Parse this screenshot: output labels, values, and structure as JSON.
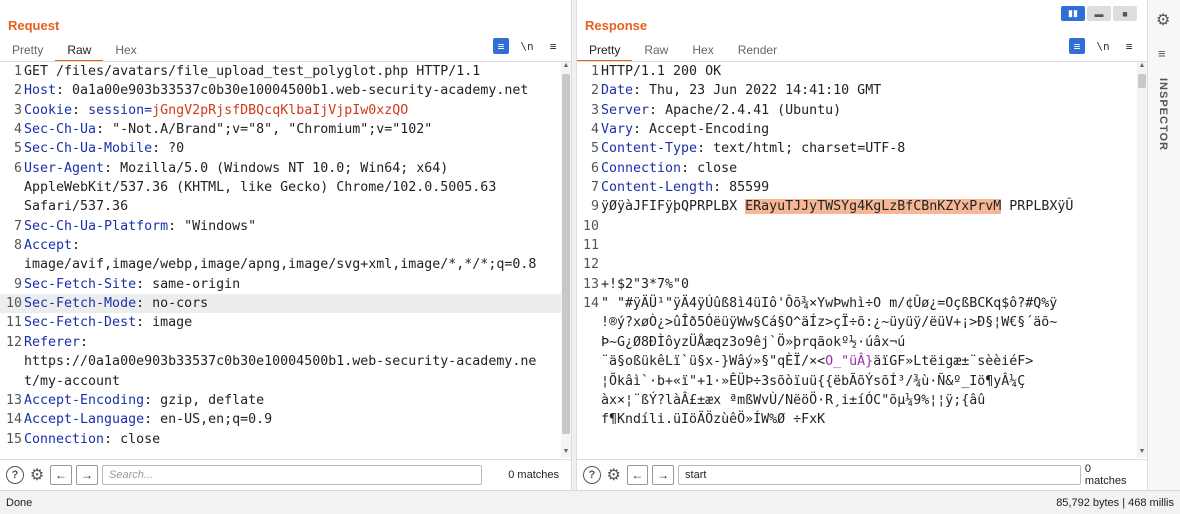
{
  "request": {
    "title": "Request",
    "tabs": [
      "Pretty",
      "Raw",
      "Hex"
    ],
    "active_tab": "Raw",
    "tools": [
      "wrap-lines",
      "\\n",
      "≡"
    ],
    "lines": [
      {
        "n": "1",
        "name": "",
        "sep": "",
        "value": "GET /files/avatars/file_upload_test_polyglot.php HTTP/1.1",
        "cont": []
      },
      {
        "n": "2",
        "name": "Host",
        "sep": ": ",
        "value": "0a1a00e903b33537c0b30e10004500b1.web-security-academy.net",
        "cont": []
      },
      {
        "n": "3",
        "name": "Cookie",
        "sep": ": ",
        "value": "session=jGngV2pRjsfDBQcqKlbaIjVjpIw0xzQO",
        "cont": []
      },
      {
        "n": "4",
        "name": "Sec-Ch-Ua",
        "sep": ": ",
        "value": "\"-Not.A/Brand\";v=\"8\", \"Chromium\";v=\"102\"",
        "cont": []
      },
      {
        "n": "5",
        "name": "Sec-Ch-Ua-Mobile",
        "sep": ": ",
        "value": "?0",
        "cont": []
      },
      {
        "n": "6",
        "name": "User-Agent",
        "sep": ": ",
        "value": "Mozilla/5.0 (Windows NT 10.0; Win64; x64)",
        "cont": [
          "AppleWebKit/537.36 (KHTML, like Gecko) Chrome/102.0.5005.63",
          "Safari/537.36"
        ]
      },
      {
        "n": "7",
        "name": "Sec-Ch-Ua-Platform",
        "sep": ": ",
        "value": "\"Windows\"",
        "cont": []
      },
      {
        "n": "8",
        "name": "Accept",
        "sep": ":",
        "value": "",
        "cont": [
          "image/avif,image/webp,image/apng,image/svg+xml,image/*,*/*;q=0.8"
        ]
      },
      {
        "n": "9",
        "name": "Sec-Fetch-Site",
        "sep": ": ",
        "value": "same-origin",
        "cont": []
      },
      {
        "n": "10",
        "name": "Sec-Fetch-Mode",
        "sep": ": ",
        "value": "no-cors",
        "cont": []
      },
      {
        "n": "11",
        "name": "Sec-Fetch-Dest",
        "sep": ": ",
        "value": "image",
        "cont": []
      },
      {
        "n": "12",
        "name": "Referer",
        "sep": ":",
        "value": "",
        "cont": [
          "https://0a1a00e903b33537c0b30e10004500b1.web-security-academy.ne",
          "t/my-account"
        ]
      },
      {
        "n": "13",
        "name": "Accept-Encoding",
        "sep": ": ",
        "value": "gzip, deflate",
        "cont": []
      },
      {
        "n": "14",
        "name": "Accept-Language",
        "sep": ": ",
        "value": "en-US,en;q=0.9",
        "cont": []
      },
      {
        "n": "15",
        "name": "Connection",
        "sep": ": ",
        "value": "close",
        "cont": []
      }
    ],
    "search_placeholder": "Search...",
    "search_value": "",
    "matches": "0 matches"
  },
  "response": {
    "title": "Response",
    "tabs": [
      "Pretty",
      "Raw",
      "Hex",
      "Render"
    ],
    "active_tab": "Pretty",
    "lines": [
      {
        "n": "1",
        "name": "",
        "sep": "",
        "value": "HTTP/1.1 200 OK"
      },
      {
        "n": "2",
        "name": "Date",
        "sep": ": ",
        "value": "Thu, 23 Jun 2022 14:41:10 GMT"
      },
      {
        "n": "3",
        "name": "Server",
        "sep": ": ",
        "value": "Apache/2.4.41 (Ubuntu)"
      },
      {
        "n": "4",
        "name": "Vary",
        "sep": ": ",
        "value": "Accept-Encoding"
      },
      {
        "n": "5",
        "name": "Content-Type",
        "sep": ": ",
        "value": "text/html; charset=UTF-8"
      },
      {
        "n": "6",
        "name": "Connection",
        "sep": ": ",
        "value": "close"
      },
      {
        "n": "7",
        "name": "Content-Length",
        "sep": ": ",
        "value": "85599"
      },
      {
        "n": "",
        "name": "",
        "sep": "",
        "value": ""
      }
    ],
    "line9": {
      "n": "9",
      "before": "ÿØÿàJFIFÿþQPRPLBX ",
      "match": "ERayuTJJyTWSYg4KgLzBfCBnKZYxPrvM",
      "after": " PRPLBXÿÛ"
    },
    "blank_lines": [
      "",
      "10",
      "11",
      "12"
    ],
    "line13": {
      "n": "13",
      "value": "+!$2\"3*7%\"0"
    },
    "line14": {
      "n": "14",
      "rows": [
        "\" \"#ÿÄÜ¹\"ÿÄ4ÿÚûß8ì4üIô'Ôõ¾×YwÞwhì÷O m/¢Ûø¿=OçßBCKq$ô?#Q%ÿ",
        "!®ý?xøÒ¿>ûÎð5ÓëüÿWw§Cá§O^äÍz>çÏ÷õ:¿~üyüÿ/ëüV+¡>Ð§¦W€§´äõ~",
        "Þ~G¿Ø8ÐÌôyzÜÅæqz3o9êj`Ö»þrqãokº½·úâx¬ú",
        "¨ä§oßükêLï`ü§x-}Wâý»§\"qÈÏ/×<"
      ],
      "row4_purple": "O_\"üÂ}",
      "row4_after": "äïGF»Ltëigæ±¨sèèiéF>",
      "more_rows": [
        "¦Õkâì`·b+«ï\"+1·»ÊÜÞ÷3sõòïuü{{ëbÃõÝsõÍ³/¾ù·Ñ&º_Iö¶yÂ¼Ç",
        "àx×¦¨ßÝ?làÂ£±æx ªmßWvÙ/NëöÖ·R¸i±íÓC\"õµ¼9%¦¦ÿ;{âû",
        "f¶Kndíli.üIöÄÖzùêÖ»ÍW%Ø ÷FxK"
      ]
    },
    "search_value": "start",
    "matches": "0 matches"
  },
  "inspector_label": "INSPECTOR",
  "status_left": "Done",
  "status_right": "85,792 bytes | 468 millis"
}
